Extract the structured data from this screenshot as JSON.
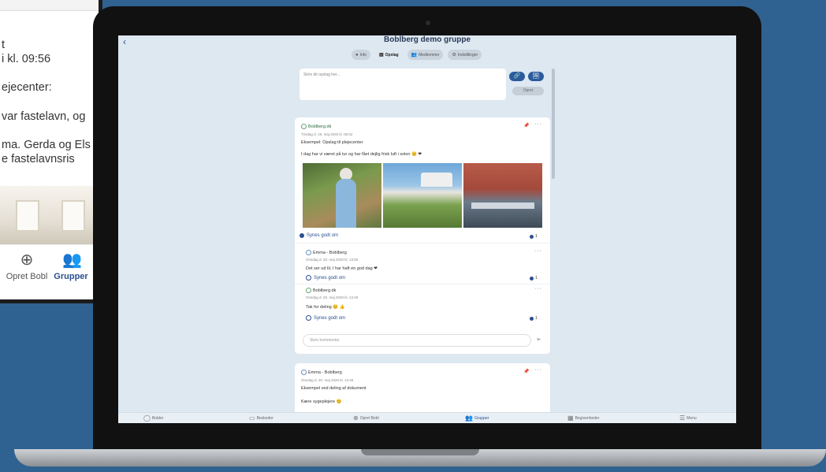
{
  "phone": {
    "lines": [
      "t",
      "i kl. 09:56",
      "",
      "ejecenter:",
      "",
      "var fastelavn, og",
      "",
      "ma. Gerda og Els",
      "e fastelavnsris"
    ],
    "nav": [
      {
        "label": "Opret Bobl",
        "icon": "plus-circle-icon",
        "active": false
      },
      {
        "label": "Grupper",
        "icon": "people-icon",
        "active": true
      }
    ]
  },
  "app": {
    "back": "‹",
    "title": "Boblberg demo gruppe",
    "tabs": [
      {
        "label": "Info",
        "icon": "●",
        "active": false
      },
      {
        "label": "Opslag",
        "icon": "▤",
        "active": true
      },
      {
        "label": "Medlemmer",
        "icon": "👥",
        "active": false
      },
      {
        "label": "Indstillinger",
        "icon": "⚙",
        "active": false
      }
    ],
    "compose": {
      "placeholder": "Skriv dit opslag her...",
      "attach_icon": "🔗",
      "image_icon": "🖼",
      "submit": "Opret"
    },
    "post1": {
      "author": "Boblberg.dk",
      "date": "Tirsdag d. 19. maj 2020 kl. 09:02",
      "intro": "Eksempel: Opslag til plejecenter",
      "text": "I dag har vi været på tur og har fået dejlig frisk luft i solen 😊 ❤",
      "likes": "Synes godt om",
      "like_count": "1",
      "comments": [
        {
          "author": "Emma - Boblberg",
          "date": "Onsdag d. 20. maj 2020 kl. 13:55",
          "text": "Det ser ud til, I har haft en god dag ❤",
          "like": "Synes godt om",
          "count": "1"
        },
        {
          "author": "Boblberg.dk",
          "date": "Onsdag d. 20. maj 2020 kl. 13:40",
          "text": "Tak for deling 😊 👍",
          "like": "Synes godt om",
          "count": "1"
        }
      ],
      "comment_placeholder": "Skriv kommentar"
    },
    "post2": {
      "author": "Emma - Boblberg",
      "date": "Onsdag d. 20. maj 2020 kl. 13:45",
      "intro": "Eksempel ved deling af dokument",
      "text": "Kære sygeplejere 😊"
    },
    "bottom_nav": [
      {
        "label": "Bobler",
        "icon": "bubble-icon",
        "active": false
      },
      {
        "label": "Beskeder",
        "icon": "message-icon",
        "active": false
      },
      {
        "label": "Opret Bobl",
        "icon": "plus-circle-icon",
        "active": false
      },
      {
        "label": "Grupper",
        "icon": "people-icon",
        "active": true
      },
      {
        "label": "Begivenheder",
        "icon": "calendar-icon",
        "active": false
      },
      {
        "label": "Menu",
        "icon": "menu-icon",
        "active": false
      }
    ]
  }
}
